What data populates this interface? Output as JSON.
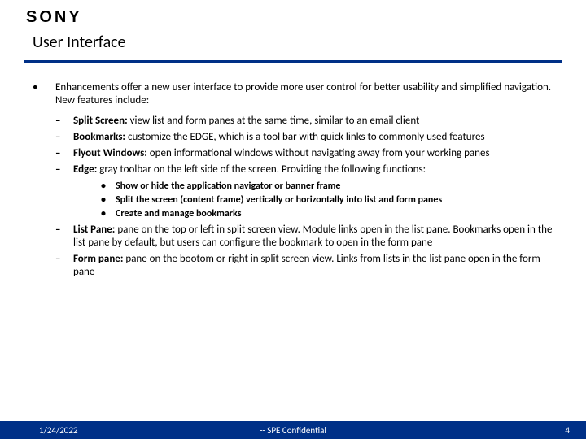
{
  "logo": "SONY",
  "title": "User Interface",
  "intro": "Enhancements offer a new user interface to provide more user control for better usability and simplified navigation.  New features include:",
  "features": [
    {
      "label": "Split Screen:",
      "desc": "  view list and form panes at the same time, similar to an email client"
    },
    {
      "label": "Bookmarks:",
      "desc": "  customize the EDGE, which is a tool bar with quick links to commonly used features"
    },
    {
      "label": "Flyout Windows:",
      "desc": "  open informational windows without navigating away from your working panes"
    },
    {
      "label": "Edge:",
      "desc": "  gray toolbar on the left side of the screen.  Providing the following functions:"
    }
  ],
  "edge_sub": [
    "Show or hide the application navigator or banner frame",
    "Split the screen (content frame) vertically or horizontally into list and form panes",
    "Create and manage bookmarks"
  ],
  "panes": [
    {
      "label": "List Pane:",
      "desc": "  pane on the top or left in split screen view.  Module links open in the list pane.  Bookmarks open in the list pane by default, but users can configure the bookmark to open in the form pane"
    },
    {
      "label": "Form pane:",
      "desc": "  pane on the bootom or right in split screen view.  Links from lists in the list pane open in the form pane"
    }
  ],
  "footer": {
    "date": "1/24/2022",
    "conf": "-- SPE Confidential",
    "page": "4"
  }
}
